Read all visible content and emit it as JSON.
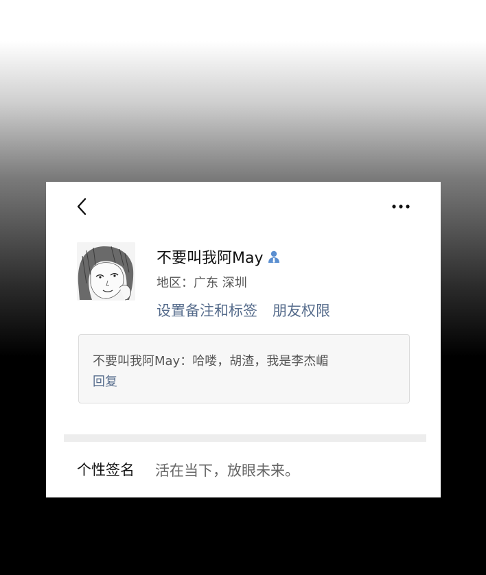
{
  "profile": {
    "name": "不要叫我阿May",
    "region": "地区：广东  深圳"
  },
  "actions": {
    "set_remark": "设置备注和标签",
    "friend_permissions": "朋友权限"
  },
  "message": {
    "text": "不要叫我阿May：哈喽，胡渣，我是李杰嵋",
    "reply": "回复"
  },
  "signature": {
    "label": "个性签名",
    "value": "活在当下，放眼未来。"
  },
  "icons": {
    "back": "chevron-left-icon",
    "more": "more-dots-icon",
    "person": "person-icon"
  },
  "colors": {
    "link": "#566c8c",
    "person_icon": "#5b8fd0"
  }
}
